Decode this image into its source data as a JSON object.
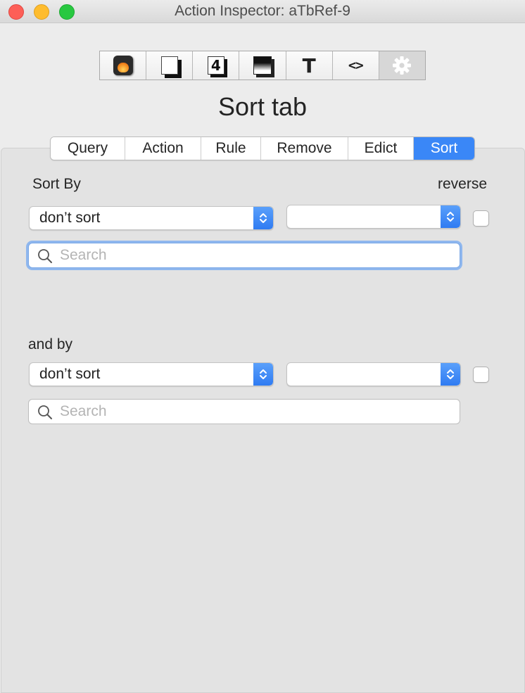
{
  "window": {
    "title": "Action Inspector: aTbRef-9"
  },
  "toolbar": {
    "buttons": [
      {
        "icon": "flame-icon",
        "active": false
      },
      {
        "icon": "page-icon",
        "active": false
      },
      {
        "icon": "number-four-icon",
        "glyph": "4",
        "active": false
      },
      {
        "icon": "gradient-icon",
        "active": false
      },
      {
        "icon": "text-icon",
        "glyph": "T",
        "active": false
      },
      {
        "icon": "code-brackets-icon",
        "glyph": "<>",
        "active": false
      },
      {
        "icon": "gear-icon",
        "active": true
      }
    ]
  },
  "page_title": "Sort tab",
  "tabs": [
    {
      "label": "Query",
      "active": false
    },
    {
      "label": "Action",
      "active": false
    },
    {
      "label": "Rule",
      "active": false
    },
    {
      "label": "Remove",
      "active": false
    },
    {
      "label": "Edict",
      "active": false
    },
    {
      "label": "Sort",
      "active": true
    }
  ],
  "sort1": {
    "label": "Sort By",
    "reverse_label": "reverse",
    "attribute_value": "don’t sort",
    "secondary_value": "",
    "reverse_checked": false,
    "search_placeholder": "Search",
    "search_value": ""
  },
  "sort2": {
    "label": "and by",
    "attribute_value": "don’t sort",
    "secondary_value": "",
    "reverse_checked": false,
    "search_placeholder": "Search",
    "search_value": ""
  },
  "colors": {
    "accent": "#3a87f7",
    "focus_ring": "#8fb7ee"
  }
}
